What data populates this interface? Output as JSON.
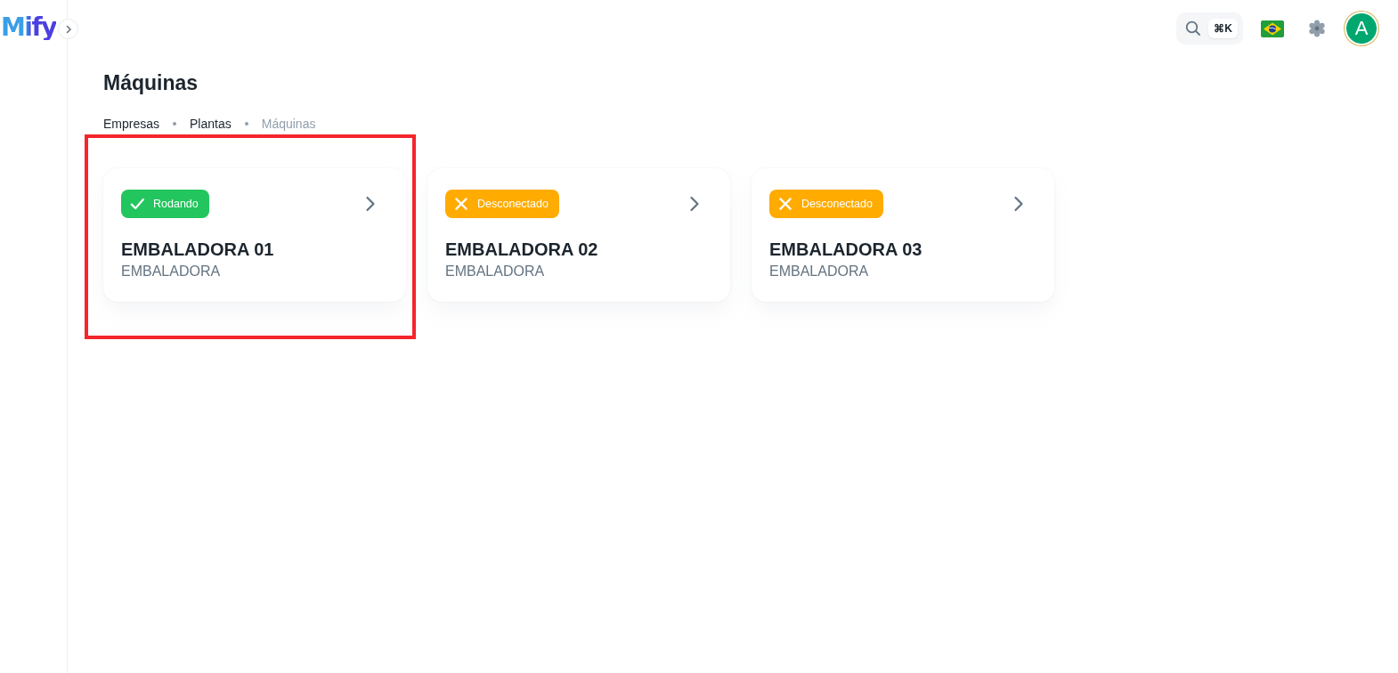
{
  "logo": {
    "text": "Mify"
  },
  "topbar": {
    "shortcut": "⌘K",
    "avatar": "A"
  },
  "page": {
    "title": "Máquinas"
  },
  "breadcrumbs": [
    {
      "label": "Empresas",
      "current": false
    },
    {
      "label": "Plantas",
      "current": false
    },
    {
      "label": "Máquinas",
      "current": true
    }
  ],
  "machines": [
    {
      "status": {
        "kind": "running",
        "label": "Rodando"
      },
      "name": "EMBALADORA 01",
      "type": "EMBALADORA",
      "highlighted": true
    },
    {
      "status": {
        "kind": "disconnected",
        "label": "Desconectado"
      },
      "name": "EMBALADORA 02",
      "type": "EMBALADORA",
      "highlighted": false
    },
    {
      "status": {
        "kind": "disconnected",
        "label": "Desconectado"
      },
      "name": "EMBALADORA 03",
      "type": "EMBALADORA",
      "highlighted": false
    }
  ]
}
